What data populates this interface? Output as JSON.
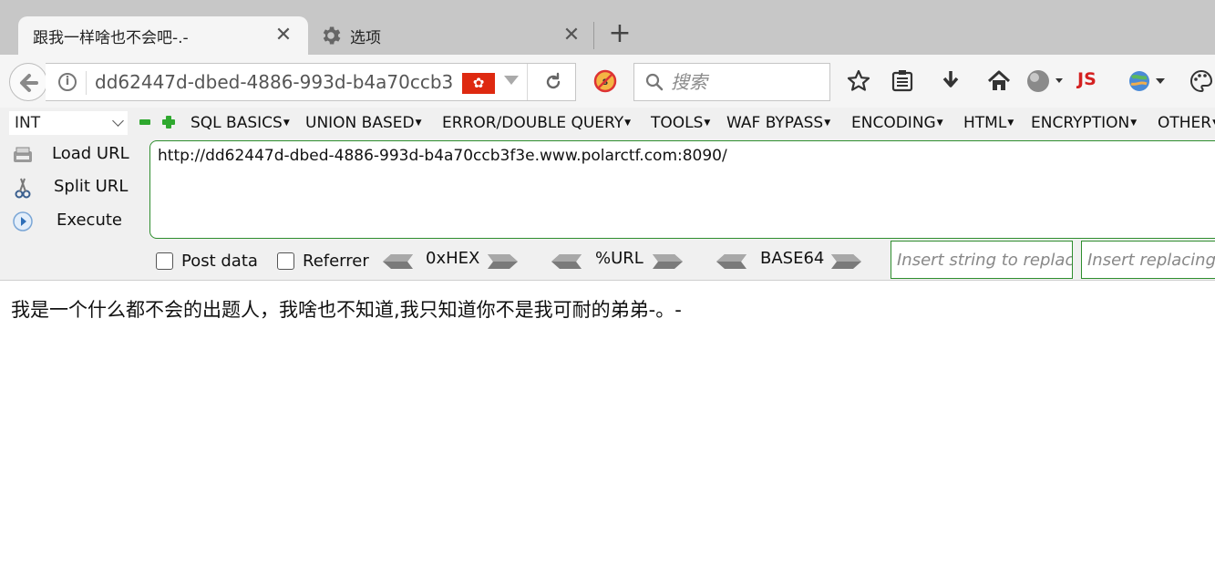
{
  "tabs": {
    "active": {
      "title": "跟我一样啥也不会吧-.-"
    },
    "inactive": {
      "title": "选项"
    }
  },
  "navbar": {
    "url": "dd62447d-dbed-4886-993d-b4a70ccb3",
    "search_placeholder": "搜索",
    "flag_icon": "hong-kong-flag-icon",
    "js_label": "JS"
  },
  "hackbar": {
    "selected_type": "INT",
    "menus": [
      "SQL BASICS",
      "UNION BASED",
      "ERROR/DOUBLE QUERY",
      "TOOLS",
      "WAF BYPASS",
      "ENCODING",
      "HTML",
      "ENCRYPTION",
      "OTHER"
    ],
    "side_actions": {
      "load_url": "Load URL",
      "split_url": "Split URL",
      "execute": "Execute"
    },
    "url_value": "http://dd62447d-dbed-4886-993d-b4a70ccb3f3e.www.polarctf.com:8090/",
    "post_data_label": "Post data",
    "referrer_label": "Referrer",
    "encoders": [
      "0xHEX",
      "%URL",
      "BASE64"
    ],
    "insert_string_placeholder": "Insert string to replace",
    "insert_replacing_placeholder": "Insert replacing string"
  },
  "page": {
    "body_text": "我是一个什么都不会的出题人，我啥也不知道,我只知道你不是我可耐的弟弟-。-"
  }
}
